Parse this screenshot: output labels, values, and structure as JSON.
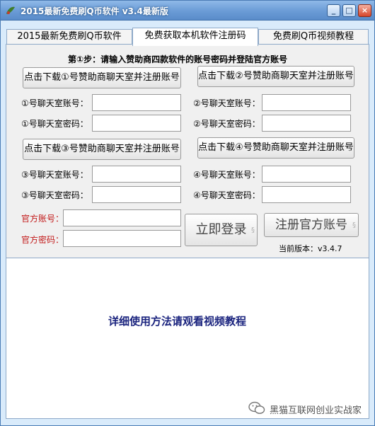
{
  "window": {
    "title": "2015最新免费刷Q币软件 v3.4最新版",
    "minimize_label": "_",
    "maximize_label": "□",
    "close_label": "×"
  },
  "tabs": [
    {
      "label": "2015最新免费刷Q币软件"
    },
    {
      "label": "免费获取本机软件注册码"
    },
    {
      "label": "免费刷Q币视频教程"
    }
  ],
  "form": {
    "step_text": "第①步：请输入赞助商四款软件的账号密码并登陆官方账号",
    "download_buttons": [
      "点击下载①号赞助商聊天室并注册账号",
      "点击下载②号赞助商聊天室并注册账号",
      "点击下载③号赞助商聊天室并注册账号",
      "点击下载④号赞助商聊天室并注册账号"
    ],
    "fields": [
      {
        "account_label": "①号聊天室账号：",
        "password_label": "①号聊天室密码：",
        "account_value": "",
        "password_value": ""
      },
      {
        "account_label": "②号聊天室账号：",
        "password_label": "②号聊天室密码：",
        "account_value": "",
        "password_value": ""
      },
      {
        "account_label": "③号聊天室账号：",
        "password_label": "③号聊天室密码：",
        "account_value": "",
        "password_value": ""
      },
      {
        "account_label": "④号聊天室账号：",
        "password_label": "④号聊天室密码：",
        "account_value": "",
        "password_value": ""
      }
    ],
    "official_account_label": "官方账号：",
    "official_password_label": "官方密码：",
    "official_account_value": "",
    "official_password_value": "",
    "login_button": "立即登录",
    "register_button": "注册官方账号",
    "version_text": "当前版本：v3.4.7"
  },
  "hint_text": "详细使用方法请观看视频教程",
  "watermark": "黑猫互联网创业实战家",
  "colors": {
    "window_bg": "#d9ebfb",
    "titlebar": "#6a9bd6",
    "label_red": "#c21a1a",
    "hint_blue": "#1a237e"
  }
}
